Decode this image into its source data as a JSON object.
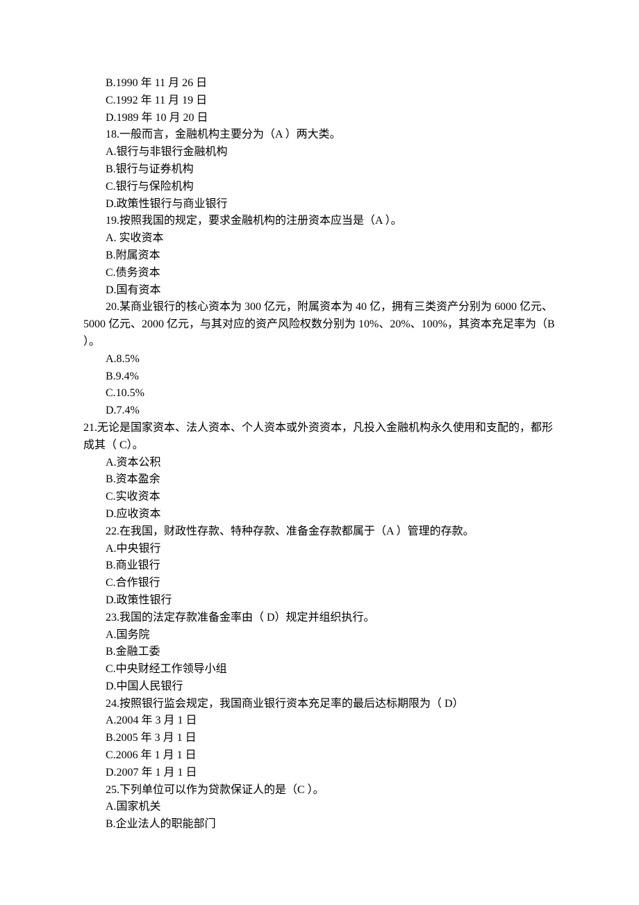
{
  "lines": [
    {
      "indent": true,
      "text": "B.1990 年 11 月 26 日"
    },
    {
      "indent": true,
      "text": "C.1992 年 11 月 19 日"
    },
    {
      "indent": true,
      "text": "D.1989 年 10 月 20 日"
    },
    {
      "indent": true,
      "text": "18.一般而言，金融机构主要分为（A  ）两大类。"
    },
    {
      "indent": true,
      "text": "A.银行与非银行金融机构"
    },
    {
      "indent": true,
      "text": "B.银行与证券机构"
    },
    {
      "indent": true,
      "text": "C.银行与保险机构"
    },
    {
      "indent": true,
      "text": "D.政策性银行与商业银行"
    },
    {
      "indent": true,
      "text": "19.按照我国的规定，要求金融机构的注册资本应当是（A  ）。"
    },
    {
      "indent": true,
      "text": "A.  实收资本"
    },
    {
      "indent": true,
      "text": "B.附属资本"
    },
    {
      "indent": true,
      "text": "C.债务资本"
    },
    {
      "indent": true,
      "text": "D.国有资本"
    },
    {
      "indent": true,
      "text": "20.某商业银行的核心资本为 300 亿元，附属资本为 40 亿，拥有三类资产分别为 6000 亿元、5000 亿元、2000 亿元，与其对应的资产风险权数分别为 10%、20%、100%，其资本充足率为（B  ）。"
    },
    {
      "indent": true,
      "text": "A.8.5%"
    },
    {
      "indent": true,
      "text": "B.9.4%"
    },
    {
      "indent": true,
      "text": "C.10.5%"
    },
    {
      "indent": true,
      "text": "D.7.4%"
    },
    {
      "indent": false,
      "text": "21.无论是国家资本、法人资本、个人资本或外资资本，凡投入金融机构永久使用和支配的，都形成其（ C）。"
    },
    {
      "indent": true,
      "text": "A.资本公积"
    },
    {
      "indent": true,
      "text": "B.资本盈余"
    },
    {
      "indent": true,
      "text": "C.实收资本"
    },
    {
      "indent": true,
      "text": "D.应收资本"
    },
    {
      "indent": true,
      "text": "22.在我国，财政性存款、特种存款、准备金存款都属于（A  ）管理的存款。"
    },
    {
      "indent": true,
      "text": "A.中央银行"
    },
    {
      "indent": true,
      "text": "B.商业银行"
    },
    {
      "indent": true,
      "text": "C.合作银行"
    },
    {
      "indent": true,
      "text": "D.政策性银行"
    },
    {
      "indent": true,
      "text": "23.我国的法定存款准备金率由（ D）规定并组织执行。"
    },
    {
      "indent": true,
      "text": "A.国务院"
    },
    {
      "indent": true,
      "text": "B.金融工委"
    },
    {
      "indent": true,
      "text": "C.中央财经工作领导小组"
    },
    {
      "indent": true,
      "text": "D.中国人民银行"
    },
    {
      "indent": true,
      "text": "24.按照银行监会规定，我国商业银行资本充足率的最后达标期限为（ D）"
    },
    {
      "indent": true,
      "text": "A.2004 年 3 月 1 日"
    },
    {
      "indent": true,
      "text": "B.2005 年 3 月 1 日"
    },
    {
      "indent": true,
      "text": "C.2006 年 1 月 1 日"
    },
    {
      "indent": true,
      "text": "D.2007 年 1 月 1 日"
    },
    {
      "indent": true,
      "text": "25.下列单位可以作为贷款保证人的是（C  ）。"
    },
    {
      "indent": true,
      "text": "A.国家机关"
    },
    {
      "indent": true,
      "text": "B.企业法人的职能部门"
    }
  ]
}
